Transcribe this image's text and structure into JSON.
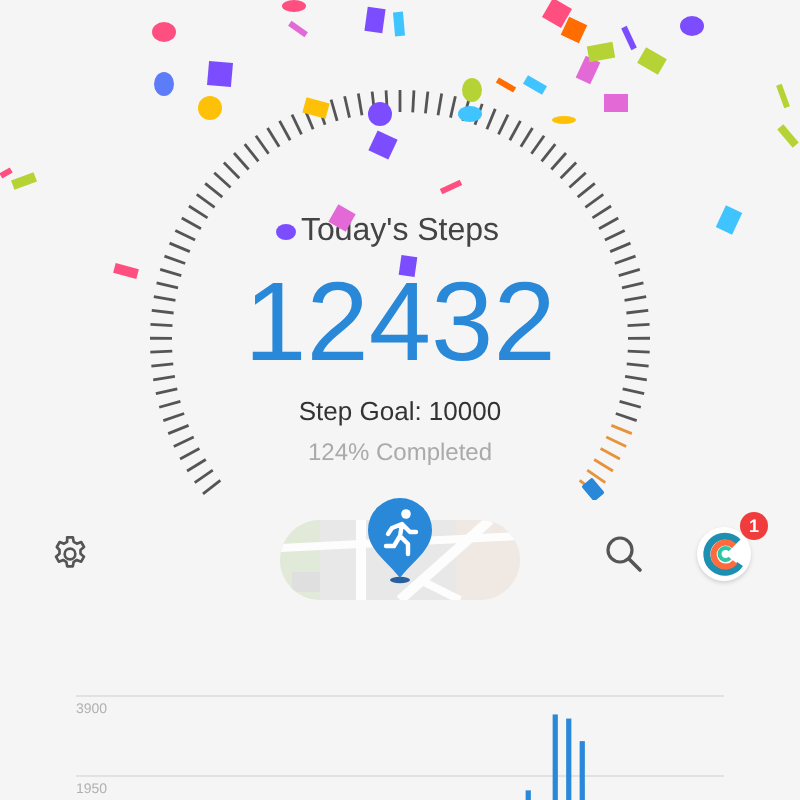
{
  "dial": {
    "title": "Today's Steps",
    "steps": "12432",
    "goal": "Step Goal: 10000",
    "completed": "124% Completed"
  },
  "toolbar": {
    "notification_count": "1"
  },
  "chart_data": {
    "type": "bar",
    "ylim": [
      0,
      3900
    ],
    "yticks": [
      1950,
      3900
    ],
    "values": [
      null,
      null,
      null,
      null,
      null,
      null,
      null,
      null,
      null,
      null,
      null,
      null,
      null,
      null,
      null,
      null,
      null,
      null,
      null,
      null,
      null,
      null,
      null,
      null,
      null,
      null,
      null,
      null,
      null,
      null,
      null,
      null,
      null,
      1600,
      null,
      3450,
      3350,
      2800,
      null,
      null,
      null,
      null,
      null,
      null,
      null,
      null,
      null,
      null
    ]
  }
}
